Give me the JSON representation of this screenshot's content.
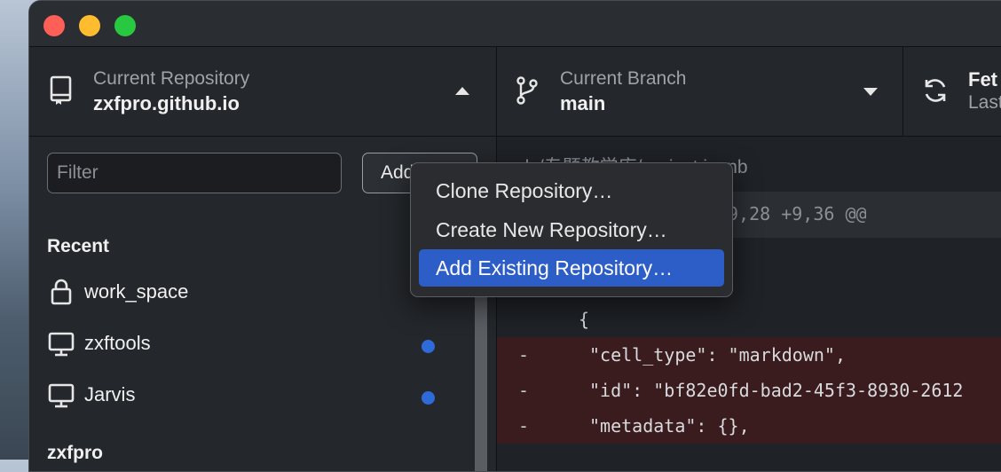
{
  "toolbar": {
    "repo": {
      "label": "Current Repository",
      "value": "zxfpro.github.io"
    },
    "branch": {
      "label": "Current Branch",
      "value": "main"
    },
    "fetch": {
      "label": "Fet",
      "sub": "Last"
    }
  },
  "sidebar": {
    "filter_placeholder": "Filter",
    "add_label": "Add",
    "recent_title": "Recent",
    "recent": [
      {
        "name": "work_space",
        "icon": "lock-icon",
        "dot": false
      },
      {
        "name": "zxftools",
        "icon": "computer-icon",
        "dot": true
      },
      {
        "name": "Jarvis",
        "icon": "computer-icon",
        "dot": true
      }
    ],
    "group_title": "zxfpro"
  },
  "diff": {
    "path": "ols/专题教学库/project.ipynb",
    "hunk": "9,28 +9,36 @@",
    "lines": [
      {
        "marker": "",
        "text": "{"
      },
      {
        "marker": "-",
        "text": "\"cell_type\": \"markdown\","
      },
      {
        "marker": "-",
        "text": "\"id\": \"bf82e0fd-bad2-45f3-8930-2612"
      },
      {
        "marker": "-",
        "text": "\"metadata\": {},"
      }
    ]
  },
  "menu": {
    "items": [
      {
        "label": "Clone Repository…",
        "selected": false
      },
      {
        "label": "Create New Repository…",
        "selected": false
      },
      {
        "label": "Add Existing Repository…",
        "selected": true
      }
    ]
  },
  "colors": {
    "accent": "#2d5ec7",
    "dot": "#2f6ad9",
    "deleted_bg": "#3a1c1e"
  }
}
